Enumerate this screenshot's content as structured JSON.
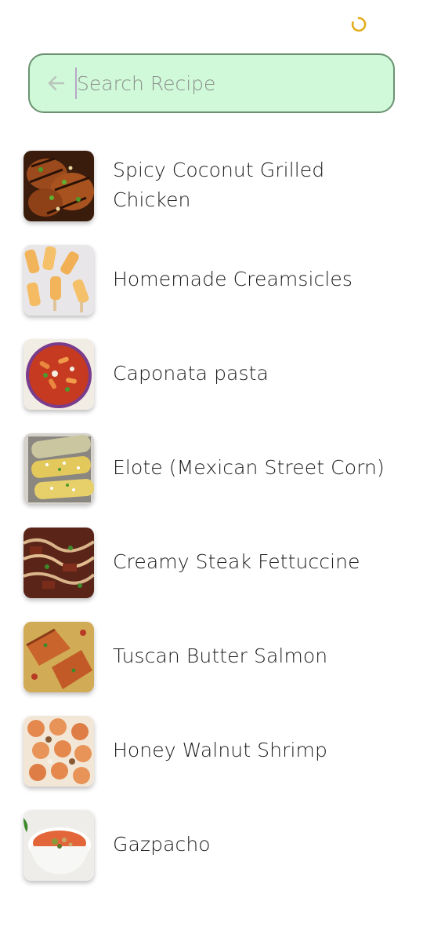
{
  "status_bar": {
    "loading_icon": "loading-spinner-icon",
    "accent_color": "#e2ae1b"
  },
  "search": {
    "placeholder": "Search Recipe",
    "value": "",
    "back_icon": "arrow-left-icon",
    "background_color": "#cff9d9",
    "border_color": "#6b9171"
  },
  "recipes": [
    {
      "title": "Spicy Coconut Grilled Chicken"
    },
    {
      "title": "Homemade Creamsicles"
    },
    {
      "title": "Caponata pasta"
    },
    {
      "title": "Elote (Mexican Street Corn)"
    },
    {
      "title": "Creamy Steak Fettuccine"
    },
    {
      "title": "Tuscan Butter Salmon"
    },
    {
      "title": "Honey Walnut Shrimp"
    },
    {
      "title": "Gazpacho"
    }
  ]
}
